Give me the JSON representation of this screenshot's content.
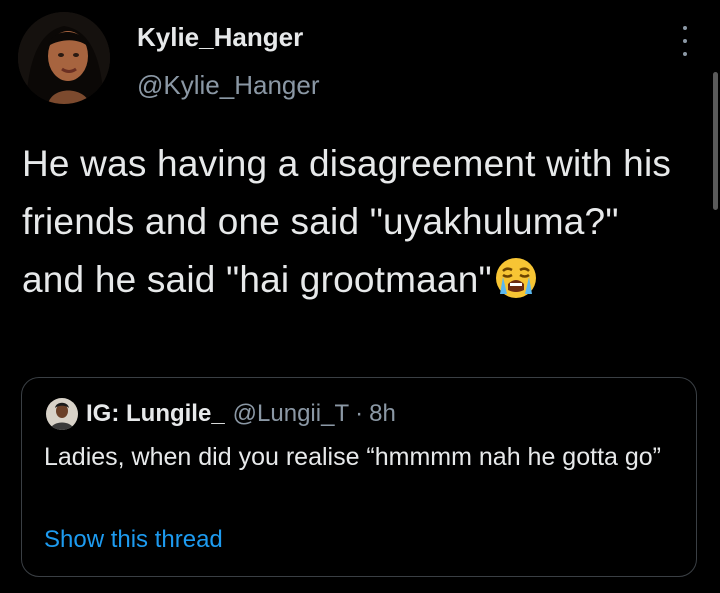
{
  "author": {
    "display_name": "Kylie_Hanger",
    "handle": "@Kylie_Hanger"
  },
  "tweet": {
    "text": "He was having a disagreement with his friends and one said \"uyakhuluma?\" and he said \"hai grootmaan\"",
    "emoji": "loudly-crying-face"
  },
  "quoted_tweet": {
    "display_name": "IG: Lungile_",
    "handle": "@Lungii_T",
    "separator": "·",
    "time": "8h",
    "text": "Ladies, when did you realise “hmmmm nah he gotta go”",
    "show_thread_label": "Show this thread"
  },
  "colors": {
    "background": "#000000",
    "primary_text": "#e7e9ea",
    "secondary_text": "#8b98a5",
    "link": "#1d9bf0",
    "card_border": "#3a3f44"
  },
  "icons": [
    "more-options-icon",
    "loudly-crying-face-emoji"
  ]
}
